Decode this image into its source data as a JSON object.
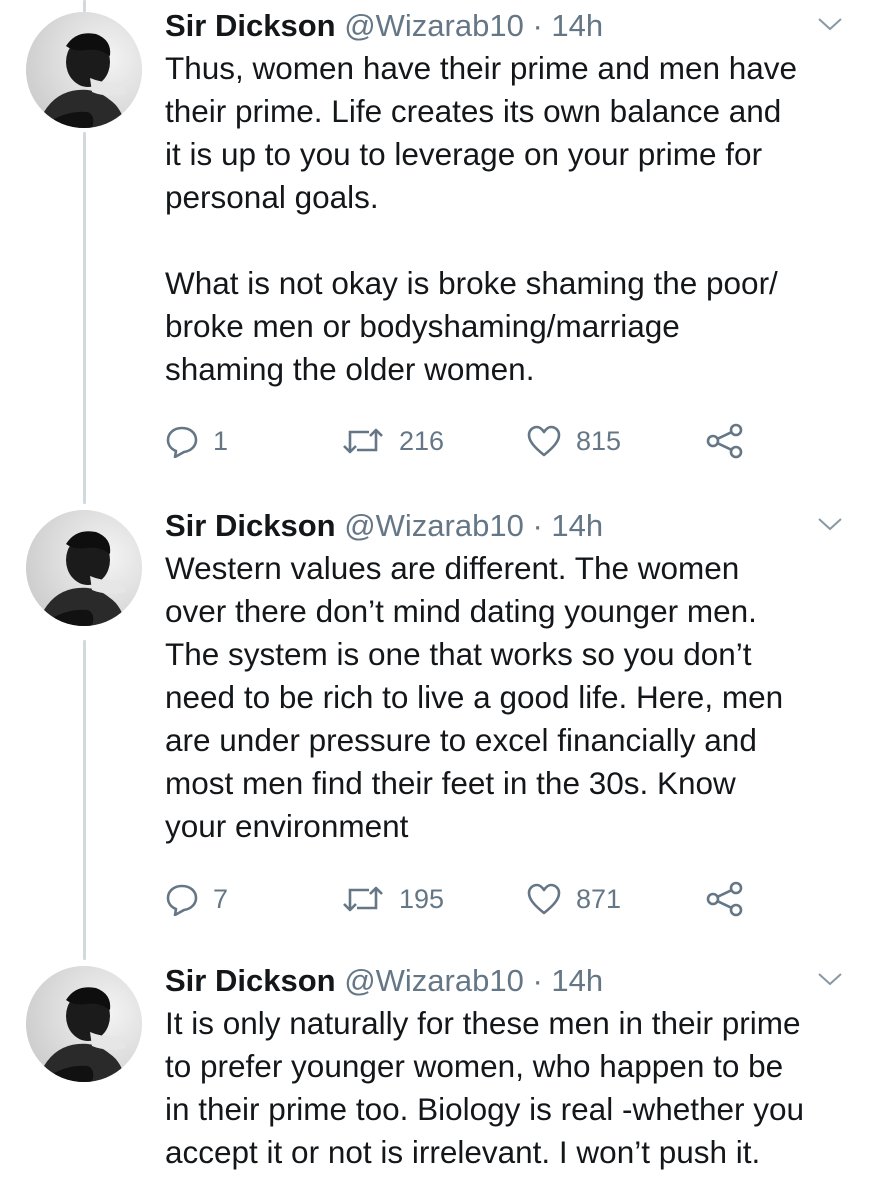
{
  "tweets": [
    {
      "author": {
        "name": "Sir Dickson",
        "handle": "@Wizarab10",
        "separator": "·",
        "time": "14h"
      },
      "text": "Thus, women have their prime and men have\ntheir prime. Life creates its own balance and\nit is up to you to leverage on your prime for\npersonal goals.\n\nWhat is not okay is broke shaming the poor/\nbroke men or bodyshaming/marriage\nshaming the older women.",
      "replies": "1",
      "retweets": "216",
      "likes": "815"
    },
    {
      "author": {
        "name": "Sir Dickson",
        "handle": "@Wizarab10",
        "separator": "·",
        "time": "14h"
      },
      "text": "Western values are different. The women\nover there don’t mind dating younger men.\nThe system is one that works so you don’t\nneed to be rich to live a good life. Here, men\nare under pressure to excel financially and\nmost men find their feet in the 30s. Know\nyour environment",
      "replies": "7",
      "retweets": "195",
      "likes": "871"
    },
    {
      "author": {
        "name": "Sir Dickson",
        "handle": "@Wizarab10",
        "separator": "·",
        "time": "14h"
      },
      "text": "It is only naturally for these men in their prime\nto prefer younger women, who happen to be\nin their prime too. Biology is real -whether you\naccept it or not is irrelevant. I won’t push it."
    }
  ],
  "icons": {
    "reply": "reply-icon",
    "retweet": "retweet-icon",
    "like": "heart-icon",
    "share": "share-icon",
    "menu": "chevron-down-icon"
  },
  "colors": {
    "text": "#14171a",
    "secondary": "#657786",
    "thread_line": "#cfd9de"
  }
}
